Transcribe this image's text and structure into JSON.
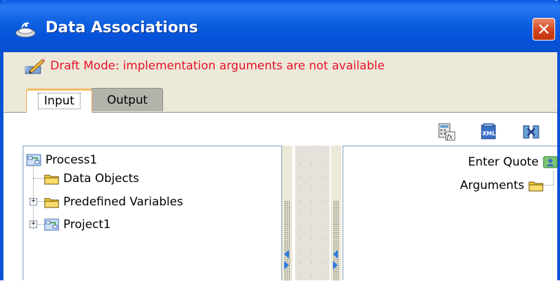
{
  "window": {
    "title": "Data Associations",
    "close_symbol": "✕"
  },
  "draft_mode": {
    "message": "Draft Mode: implementation arguments are not available"
  },
  "tabs": [
    {
      "label": "Input",
      "selected": true
    },
    {
      "label": "Output",
      "selected": false
    }
  ],
  "toolbar": {
    "icons": [
      "expression-builder-icon",
      "xml-icon",
      "transform-icon"
    ]
  },
  "left_tree": {
    "root": "Process1",
    "children": [
      "Data Objects",
      "Predefined Variables",
      "Project1"
    ]
  },
  "right_tree": {
    "root": "Enter Quote",
    "children": [
      "Arguments"
    ]
  },
  "colors": {
    "accent": "#0a52d6",
    "warning": "#e8102a",
    "tab_selected_border": "#f1a84a"
  }
}
